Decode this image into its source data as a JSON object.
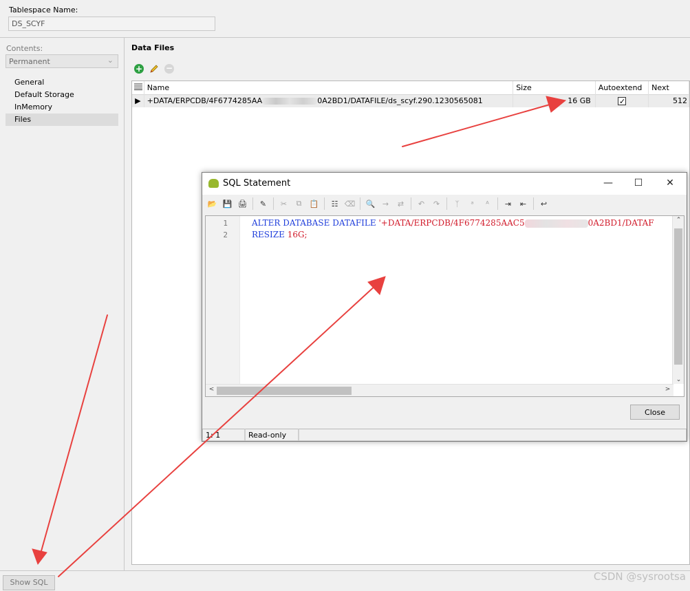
{
  "tablespace": {
    "label": "Tablespace Name:",
    "value": "DS_SCYF"
  },
  "contents": {
    "label": "Contents:",
    "selected": "Permanent"
  },
  "nav": {
    "items": [
      {
        "label": "General"
      },
      {
        "label": "Default Storage"
      },
      {
        "label": "InMemory"
      },
      {
        "label": "Files"
      }
    ],
    "active": "Files"
  },
  "data_files": {
    "title": "Data Files",
    "toolbar": {
      "add_icon": "add-icon",
      "edit_icon": "pencil-icon",
      "remove_icon": "remove-icon"
    },
    "columns": [
      "Name",
      "Size",
      "Autoextend",
      "Next"
    ],
    "rows": [
      {
        "name_prefix": "+DATA/ERPCDB/4F6774285AA",
        "name_suffix": "0A2BD1/DATAFILE/ds_scyf.290.1230565081",
        "size": "16 GB",
        "autoextend": true,
        "next": "512"
      }
    ]
  },
  "show_sql_button": "Show SQL",
  "watermark": "CSDN @sysrootsa",
  "sql_dialog": {
    "title": "SQL Statement",
    "line_numbers": [
      "1",
      "2"
    ],
    "code": {
      "line1_keywords": "ALTER DATABASE DATAFILE",
      "line1_string_prefix": "'+DATA/ERPCDB/4F6774285AAC5",
      "line1_string_suffix": "0A2BD1/DATAF",
      "line2_keyword": "RESIZE",
      "line2_value": "16G;"
    },
    "close_button": "Close",
    "status": {
      "position": "1:  1",
      "mode": "Read-only"
    }
  },
  "colors": {
    "keyword": "#1e3ddb",
    "string": "#d11a2a",
    "annotation_arrow": "#e8413f"
  }
}
